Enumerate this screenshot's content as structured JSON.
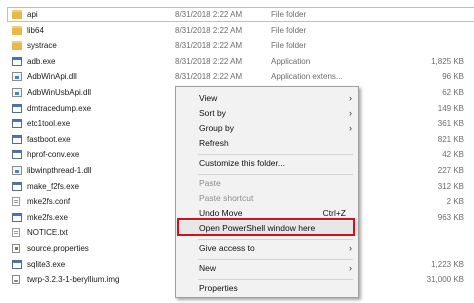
{
  "files": [
    {
      "name": "api",
      "date": "8/31/2018 2:22 AM",
      "type": "File folder",
      "size": "",
      "icon": "folder-icon",
      "selected": true
    },
    {
      "name": "lib64",
      "date": "8/31/2018 2:22 AM",
      "type": "File folder",
      "size": "",
      "icon": "folder-icon"
    },
    {
      "name": "systrace",
      "date": "8/31/2018 2:22 AM",
      "type": "File folder",
      "size": "",
      "icon": "folder-icon"
    },
    {
      "name": "adb.exe",
      "date": "8/31/2018 2:22 AM",
      "type": "Application",
      "size": "1,825 KB",
      "icon": "app-icon"
    },
    {
      "name": "AdbWinApi.dll",
      "date": "8/31/2018 2:22 AM",
      "type": "Application extens...",
      "size": "96 KB",
      "icon": "dll-icon"
    },
    {
      "name": "AdbWinUsbApi.dll",
      "date": "8/31/2018 2:22 AM",
      "type": "Application extens...",
      "size": "62 KB",
      "icon": "dll-icon"
    },
    {
      "name": "dmtracedump.exe",
      "date": "",
      "type": "",
      "size": "149 KB",
      "icon": "app-icon"
    },
    {
      "name": "etc1tool.exe",
      "date": "",
      "type": "",
      "size": "361 KB",
      "icon": "app-icon"
    },
    {
      "name": "fastboot.exe",
      "date": "",
      "type": "",
      "size": "821 KB",
      "icon": "app-icon"
    },
    {
      "name": "hprof-conv.exe",
      "date": "",
      "type": "",
      "size": "42 KB",
      "icon": "app-icon"
    },
    {
      "name": "libwinpthread-1.dll",
      "date": "",
      "type": "",
      "size": "227 KB",
      "icon": "dll-icon"
    },
    {
      "name": "make_f2fs.exe",
      "date": "",
      "type": "",
      "size": "312 KB",
      "icon": "app-icon"
    },
    {
      "name": "mke2fs.conf",
      "date": "",
      "type": "",
      "size": "2 KB",
      "icon": "doc-icon"
    },
    {
      "name": "mke2fs.exe",
      "date": "",
      "type": "",
      "size": "963 KB",
      "icon": "app-icon"
    },
    {
      "name": "NOTICE.txt",
      "date": "",
      "type": "",
      "size": "",
      "icon": "doc-icon"
    },
    {
      "name": "source.properties",
      "date": "",
      "type": "",
      "size": "",
      "icon": "properties-file-icon"
    },
    {
      "name": "sqlite3.exe",
      "date": "",
      "type": "",
      "size": "1,223 KB",
      "icon": "app-icon"
    },
    {
      "name": "twrp-3.2.3-1-beryllium.img",
      "date": "",
      "type": "",
      "size": "31,000 KB",
      "icon": "image-file-icon"
    }
  ],
  "menu": {
    "view": "View",
    "sort_by": "Sort by",
    "group_by": "Group by",
    "refresh": "Refresh",
    "customize": "Customize this folder...",
    "paste": "Paste",
    "paste_shortcut": "Paste shortcut",
    "undo_move": "Undo Move",
    "undo_shortcut": "Ctrl+Z",
    "open_powershell": "Open PowerShell window here",
    "give_access": "Give access to",
    "new": "New",
    "properties": "Properties",
    "arrow": "›"
  },
  "colors": {
    "highlight_border": "#d0101c",
    "menu_bg": "#f2f2f2",
    "folder": "#e8b84a"
  }
}
